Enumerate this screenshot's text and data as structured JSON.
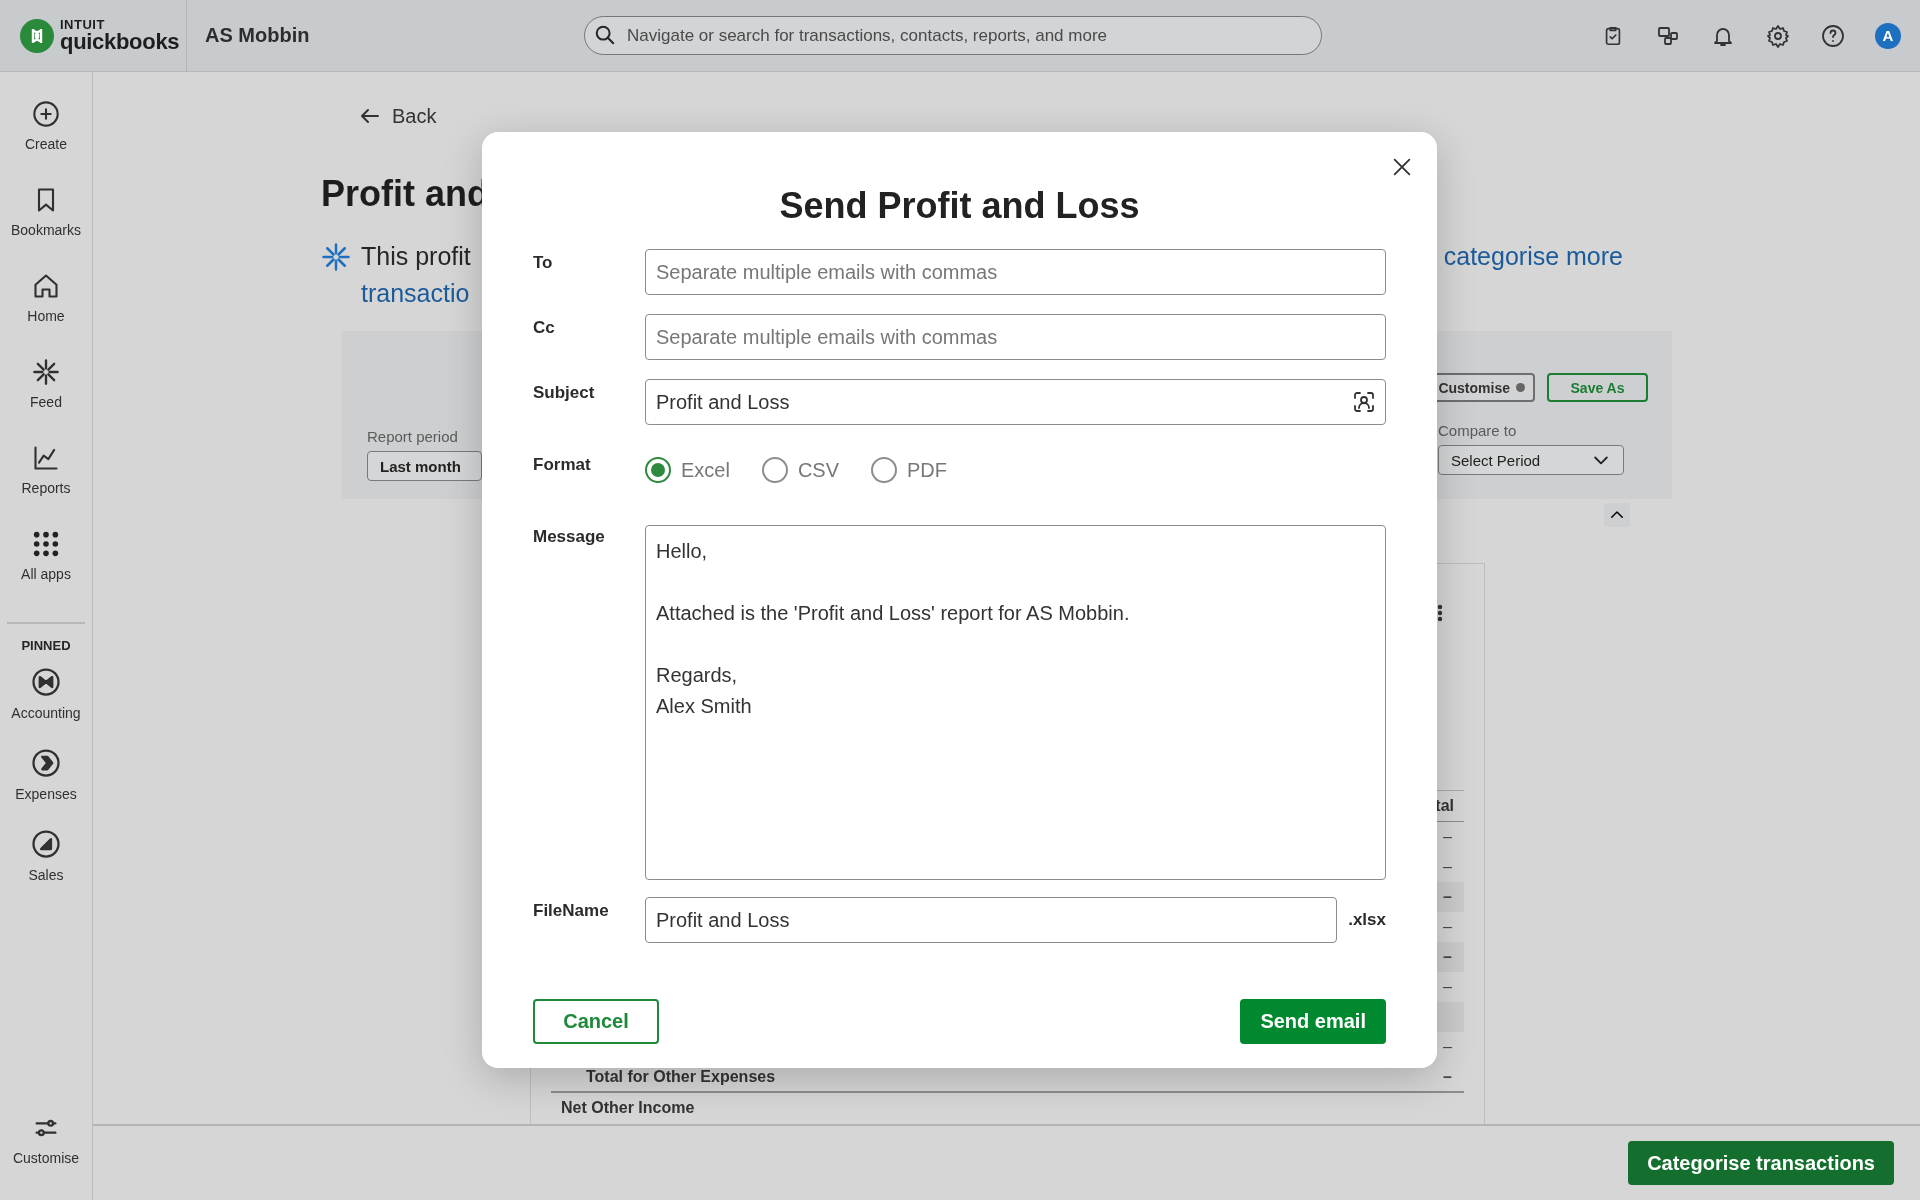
{
  "topbar": {
    "brand_small": "INTUIT",
    "brand": "quickbooks",
    "company": "AS Mobbin",
    "search": {
      "placeholder": "Navigate or search for transactions, contacts, reports, and more"
    },
    "avatar": "A"
  },
  "sidebar": {
    "items": [
      {
        "label": "Create"
      },
      {
        "label": "Bookmarks"
      },
      {
        "label": "Home"
      },
      {
        "label": "Feed"
      },
      {
        "label": "Reports"
      },
      {
        "label": "All apps"
      }
    ],
    "pinned_heading": "PINNED",
    "pinned": [
      {
        "label": "Accounting"
      },
      {
        "label": "Expenses"
      },
      {
        "label": "Sales"
      }
    ],
    "footer": {
      "label": "Customise"
    }
  },
  "page": {
    "back": "Back",
    "title": "Profit and",
    "notice": {
      "text": "This profit",
      "link_left": "transactio",
      "link_right": "categorise more"
    },
    "filters": {
      "report_period_label": "Report period",
      "report_period": "Last month",
      "customise": "Customise",
      "save_as": "Save As",
      "compare_label": "Compare to",
      "compare": "Select Period"
    },
    "report": {
      "column_heading": "tal",
      "rows": [
        {
          "kind": "item",
          "value": "–"
        },
        {
          "kind": "item",
          "value": "–"
        },
        {
          "kind": "subtotal",
          "value": "–"
        },
        {
          "kind": "item",
          "value": "–"
        },
        {
          "kind": "subtotal",
          "value": "–"
        },
        {
          "kind": "item",
          "value": "–"
        },
        {
          "kind": "heading"
        },
        {
          "kind": "item",
          "value": "–"
        },
        {
          "kind": "total",
          "label": "Total for Other Expenses",
          "value": "–"
        },
        {
          "kind": "net",
          "label": "Net Other Income"
        }
      ]
    }
  },
  "footer": {
    "button": "Categorise transactions"
  },
  "dialog": {
    "title": "Send Profit and Loss",
    "fields": [
      {
        "label": "To",
        "kind": "text",
        "placeholder": "Separate multiple emails with commas"
      },
      {
        "label": "Cc",
        "kind": "text",
        "placeholder": "Separate multiple emails with commas"
      },
      {
        "label": "Subject",
        "kind": "action",
        "value": "Profit and Loss"
      }
    ],
    "format": {
      "label": "Format",
      "options": [
        {
          "label": "Excel",
          "selected": true
        },
        {
          "label": "CSV",
          "selected": false
        },
        {
          "label": "PDF",
          "selected": false
        }
      ]
    },
    "message": {
      "label": "Message",
      "value": "Hello,\n\nAttached is the 'Profit and Loss' report for AS Mobbin.\n\nRegards,\nAlex Smith"
    },
    "filename": {
      "label": "FileName",
      "value": "Profit and Loss",
      "extension": ".xlsx"
    },
    "cancel": "Cancel",
    "send": "Send email"
  }
}
